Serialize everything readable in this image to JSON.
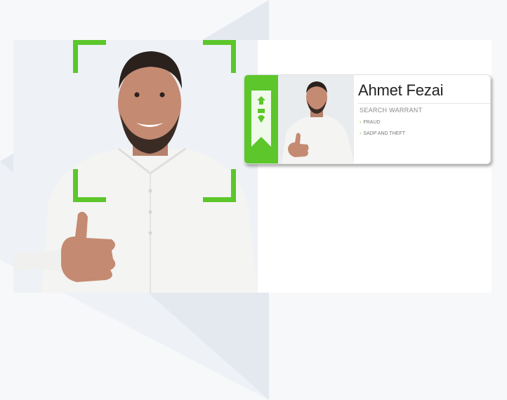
{
  "profile_card": {
    "name": "Ahmet Fezai",
    "subtitle": "SEARCH WARRANT",
    "items": [
      {
        "label": "FRAUD"
      },
      {
        "label": "SADP AND THEFT"
      }
    ]
  },
  "colors": {
    "accent": "#5cc62b",
    "background": "#f7f8fa",
    "triangle": "#e4e9f0"
  },
  "icons": {
    "bullet": "chevron-right-icon",
    "ribbon": "emblem-bookmark-icon"
  }
}
